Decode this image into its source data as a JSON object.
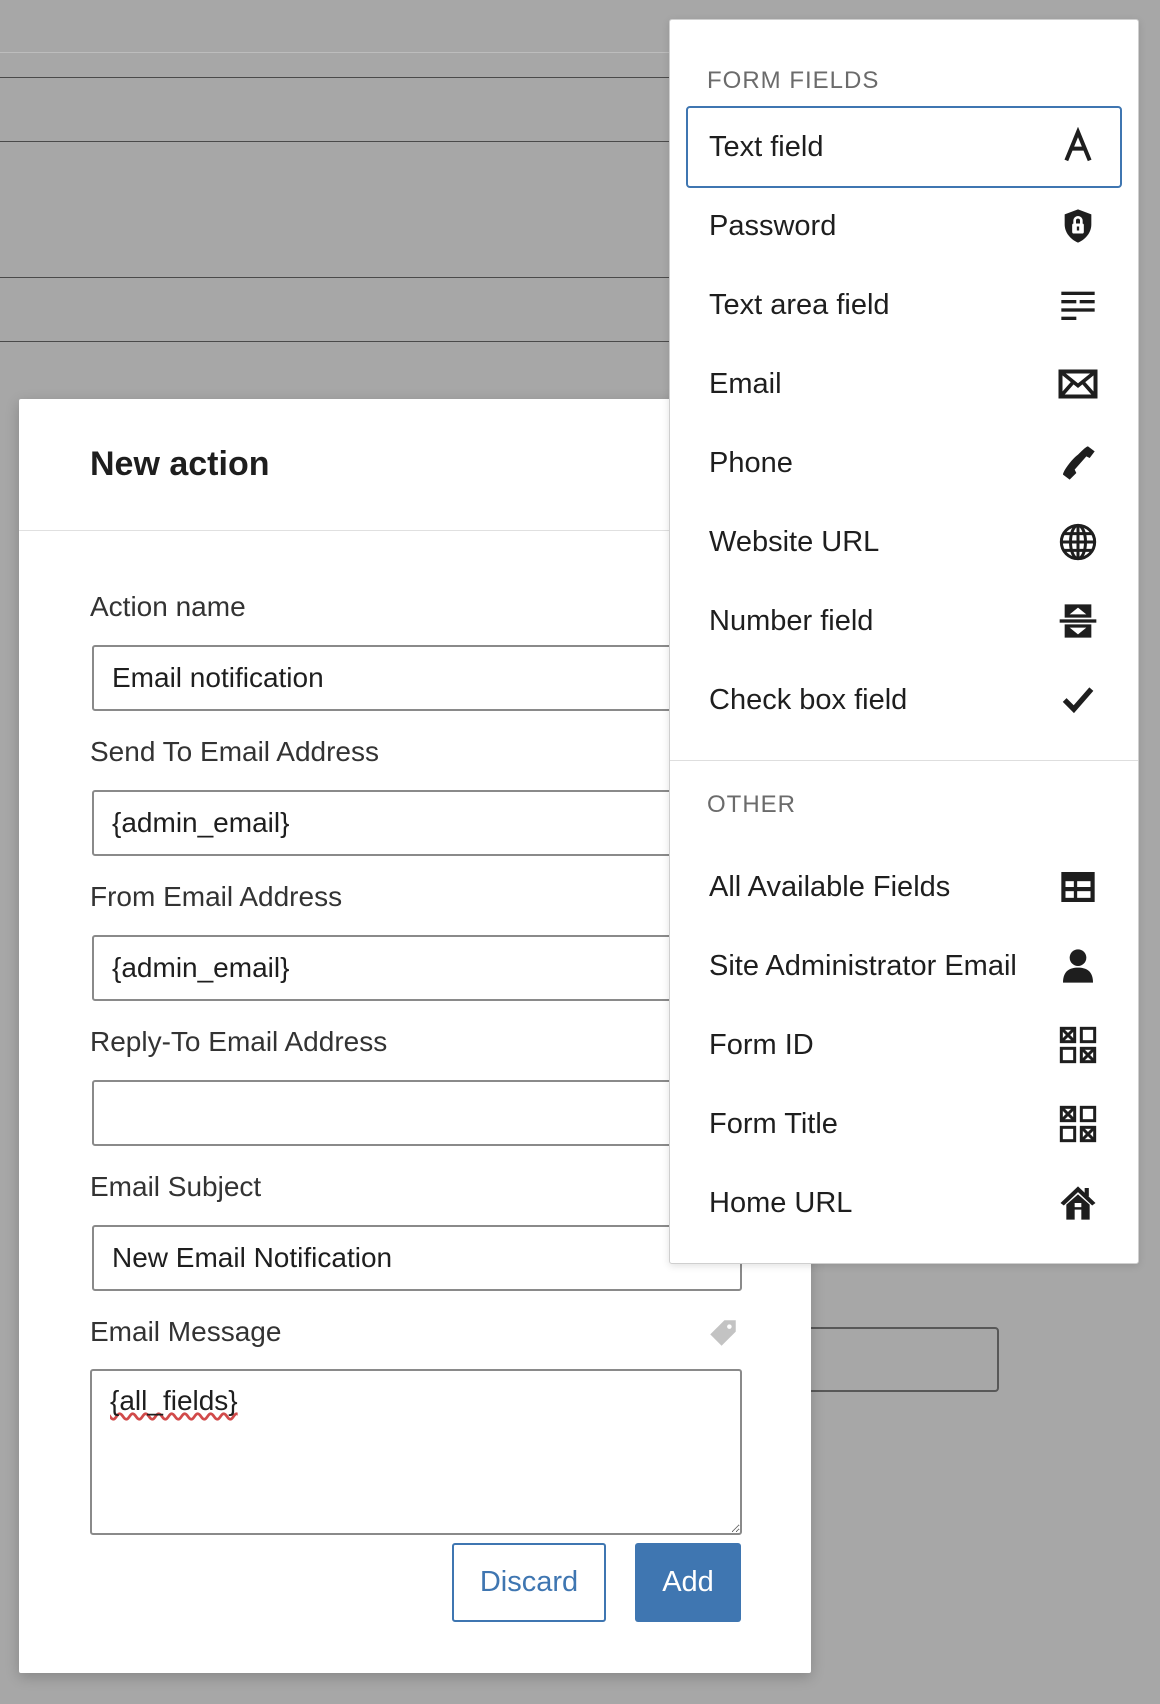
{
  "modal": {
    "title": "New action",
    "fields": {
      "action_name": {
        "label": "Action name",
        "value": "Email notification"
      },
      "send_to": {
        "label": "Send To Email Address",
        "value": "{admin_email}"
      },
      "from": {
        "label": "From Email Address",
        "value": "{admin_email}"
      },
      "reply_to": {
        "label": "Reply-To Email Address",
        "value": ""
      },
      "subject": {
        "label": "Email Subject",
        "value": "New Email Notification"
      },
      "message": {
        "label": "Email Message",
        "value": "{all_fields}"
      }
    },
    "buttons": {
      "discard": "Discard",
      "add": "Add"
    }
  },
  "dropdown": {
    "form_fields_heading": "FORM FIELDS",
    "form_fields": [
      {
        "label": "Text field",
        "icon": "text-a-icon",
        "selected": true
      },
      {
        "label": "Password",
        "icon": "shield-lock-icon"
      },
      {
        "label": "Text area field",
        "icon": "text-lines-icon"
      },
      {
        "label": "Email",
        "icon": "envelope-icon"
      },
      {
        "label": "Phone",
        "icon": "phone-icon"
      },
      {
        "label": "Website URL",
        "icon": "globe-icon"
      },
      {
        "label": "Number field",
        "icon": "number-stepper-icon"
      },
      {
        "label": "Check box field",
        "icon": "checkmark-icon"
      }
    ],
    "other_heading": "OTHER",
    "other": [
      {
        "label": "All Available Fields",
        "icon": "table-icon"
      },
      {
        "label": "Site Administrator Email",
        "icon": "user-icon"
      },
      {
        "label": "Form ID",
        "icon": "grid-icon"
      },
      {
        "label": "Form Title",
        "icon": "grid-icon"
      },
      {
        "label": "Home URL",
        "icon": "home-icon"
      }
    ]
  },
  "colors": {
    "accent": "#3f76b1",
    "overlay": "#a7a7a7"
  }
}
